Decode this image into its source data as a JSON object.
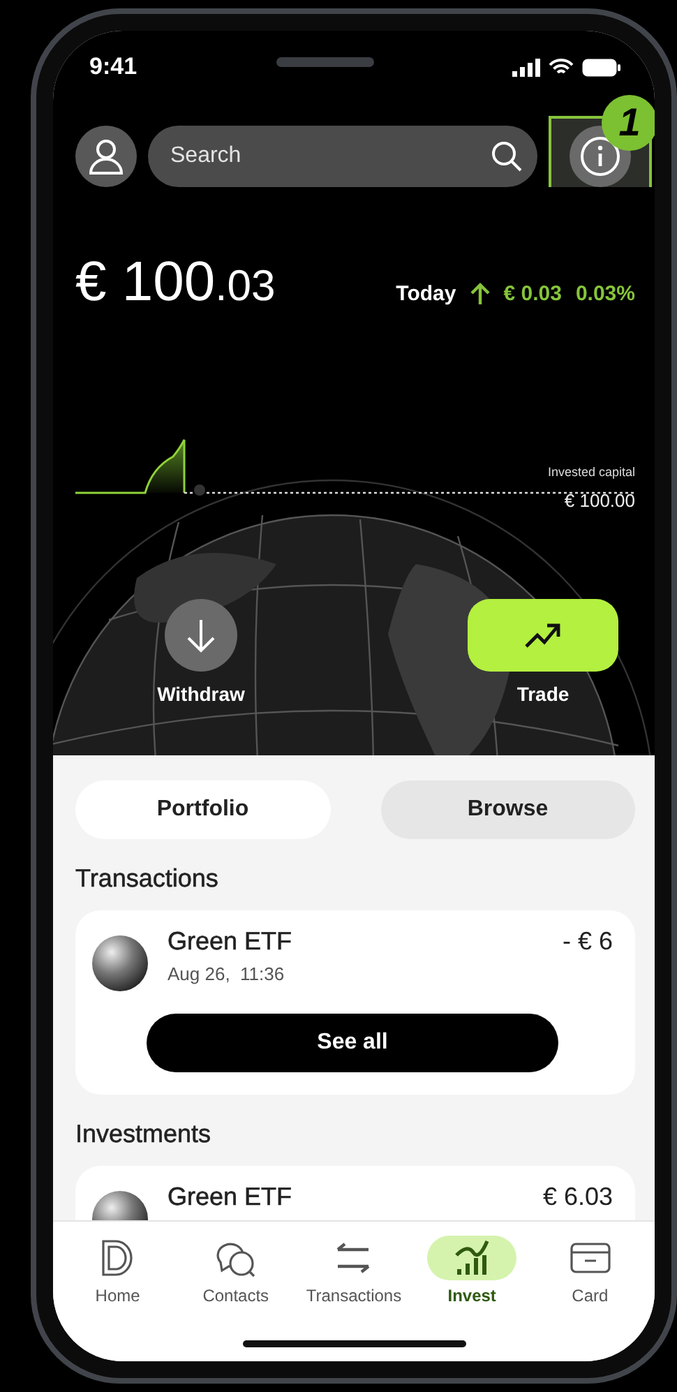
{
  "status_bar": {
    "time": "9:41"
  },
  "header": {
    "search": {
      "placeholder": "Search"
    },
    "callout": {
      "label": "1"
    }
  },
  "balance": {
    "whole": "€ 100",
    "fraction": ".03"
  },
  "today": {
    "label": "Today",
    "change": "€ 0.03",
    "percent": "0.03%"
  },
  "chart": {
    "label": "Invested capital",
    "value": "€ 100.00"
  },
  "actions": [
    {
      "kind": "withdraw",
      "label": "Withdraw"
    },
    {
      "kind": "trade",
      "label": "Trade"
    }
  ],
  "tabs": [
    {
      "label": "Portfolio",
      "selected": true
    },
    {
      "label": "Browse",
      "selected": false
    }
  ],
  "transactions": {
    "title": "Transactions",
    "items": [
      {
        "name": "Green ETF",
        "date": "Aug 26,  11:36",
        "amount": "- € 6"
      }
    ],
    "button": "See all"
  },
  "investments": {
    "title": "Investments",
    "items": [
      {
        "name": "Green ETF",
        "amount": "€ 6.03"
      }
    ]
  },
  "nav": [
    {
      "kind": "home",
      "label": "Home",
      "selected": false
    },
    {
      "kind": "contacts",
      "label": "Contacts",
      "selected": false
    },
    {
      "kind": "transactions",
      "label": "Transactions",
      "selected": false
    },
    {
      "kind": "invest",
      "label": "Invest",
      "selected": true
    },
    {
      "kind": "card",
      "label": "Card",
      "selected": false
    }
  ]
}
